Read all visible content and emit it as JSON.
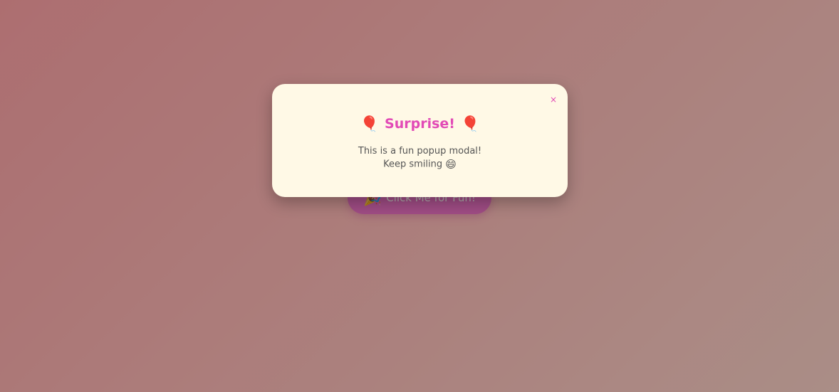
{
  "page": {
    "background_gradient": [
      "#ff9a9e",
      "#fad0c4"
    ]
  },
  "fun_button": {
    "icon": "party-popper-icon",
    "icon_glyph": "🎉",
    "label": "Click Me for Fun!",
    "color": "#e75fc0"
  },
  "modal": {
    "title": "Surprise!",
    "title_icon": "balloon-icon",
    "title_icon_glyph": "🎈",
    "title_color": "#e24ab6",
    "close_label": "×",
    "message_line1": "This is a fun popup modal!",
    "message_line2": "Keep smiling",
    "message_icon": "grinning-face-icon",
    "message_icon_glyph": "😄",
    "background": "#fff9e6"
  }
}
